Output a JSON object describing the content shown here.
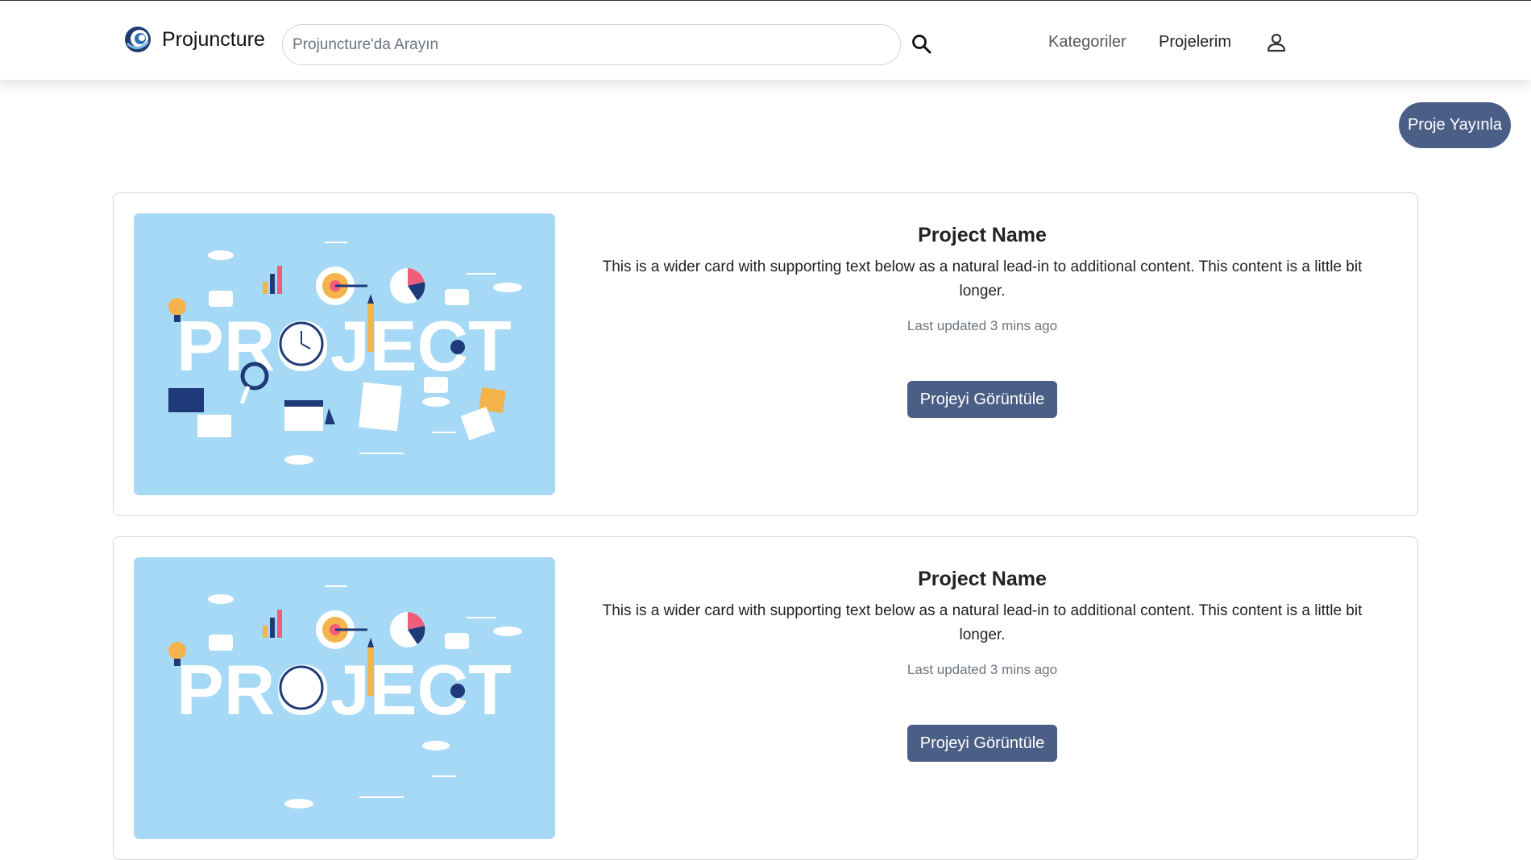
{
  "header": {
    "brand": "Projuncture",
    "search_placeholder": "Projuncture'da Arayın",
    "nav": {
      "categories": "Kategoriler",
      "my_projects": "Projelerim"
    }
  },
  "publish_button": "Proje Yayınla",
  "cards": [
    {
      "image_text": "PROJECT",
      "title": "Project Name",
      "text": "This is a wider card with supporting text below as a natural lead-in to additional content. This content is a little bit longer.",
      "updated": "Last updated 3 mins ago",
      "button": "Projeyi Görüntüle"
    },
    {
      "image_text": "PROJECT",
      "title": "Project Name",
      "text": "This is a wider card with supporting text below as a natural lead-in to additional content. This content is a little bit longer.",
      "updated": "Last updated 3 mins ago",
      "button": "Projeyi Görüntüle"
    }
  ],
  "colors": {
    "accent": "#4b5f86",
    "image_bg": "#a6d9f5"
  }
}
